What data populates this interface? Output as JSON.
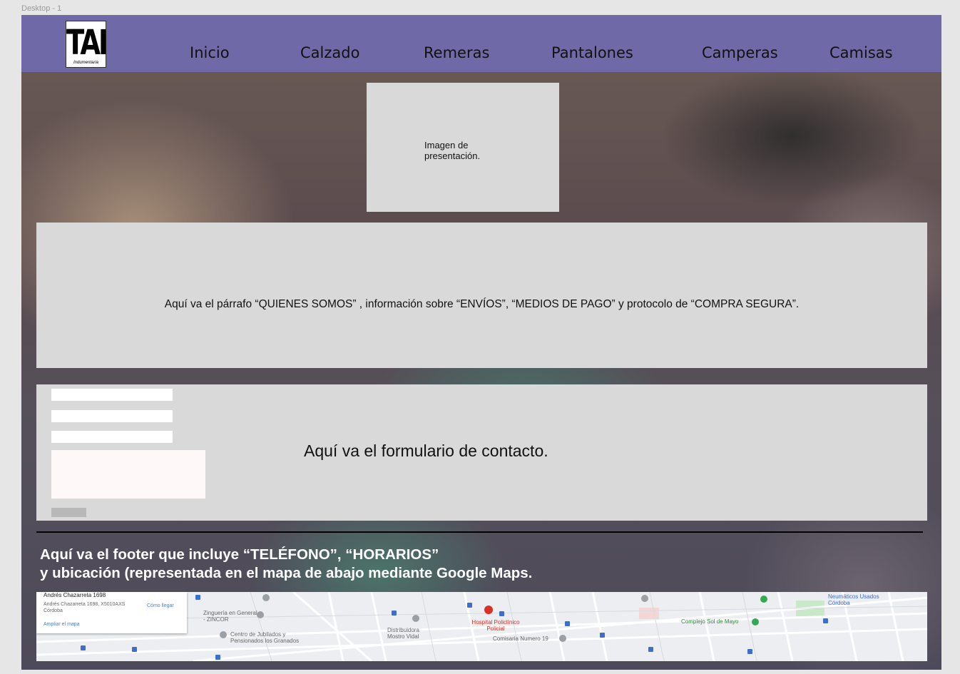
{
  "canvas": {
    "label": "Desktop - 1"
  },
  "logo": {
    "mark": "TAI",
    "subtitle": "Indumentaria"
  },
  "nav": {
    "items": [
      {
        "label": "Inicio"
      },
      {
        "label": "Calzado"
      },
      {
        "label": "Remeras"
      },
      {
        "label": "Pantalones"
      },
      {
        "label": "Camperas"
      },
      {
        "label": "Camisas"
      }
    ]
  },
  "hero": {
    "placeholder_text": "Imagen de presentación."
  },
  "about": {
    "text": "Aquí va el párrafo “QUIENES SOMOS” , información sobre “ENVÍOS”, “MEDIOS DE PAGO” y protocolo de “COMPRA SEGURA”."
  },
  "contact": {
    "text": "Aquí va el formulario de contacto."
  },
  "footer": {
    "line1": "Aquí va el footer que incluye “TELÉFONO”, “HORARIOS”",
    "line2": "y ubicación (representada en el mapa de abajo mediante Google Maps."
  },
  "map": {
    "card": {
      "title": "Andrés Chazarreta 1698",
      "address": "Andrés Chazarreta 1698, X5010AXS Córdoba",
      "directions": "Cómo llegar",
      "link": "Ampliar el mapa"
    },
    "places": [
      {
        "label": "Zinguería en General - ZINCOR",
        "tone": "grey"
      },
      {
        "label": "Centro de Jubilados y Pensionados los Granados",
        "tone": "grey"
      },
      {
        "label": "Distribuidora Mostro Vidal",
        "tone": "grey"
      },
      {
        "label": "Hospital Policlínico Policial",
        "tone": "red"
      },
      {
        "label": "Comisaria Numero 19",
        "tone": "grey"
      },
      {
        "label": "Complejo Sol de Mayo",
        "tone": "green"
      },
      {
        "label": "Neumáticos Usados Córdoba",
        "tone": "blue"
      }
    ],
    "colors": {
      "road": "#ffffff",
      "block": "#e8eaed",
      "park": "#c9e8c9",
      "water_pin": "#3b6fcf",
      "hospital": "#d93025"
    }
  }
}
